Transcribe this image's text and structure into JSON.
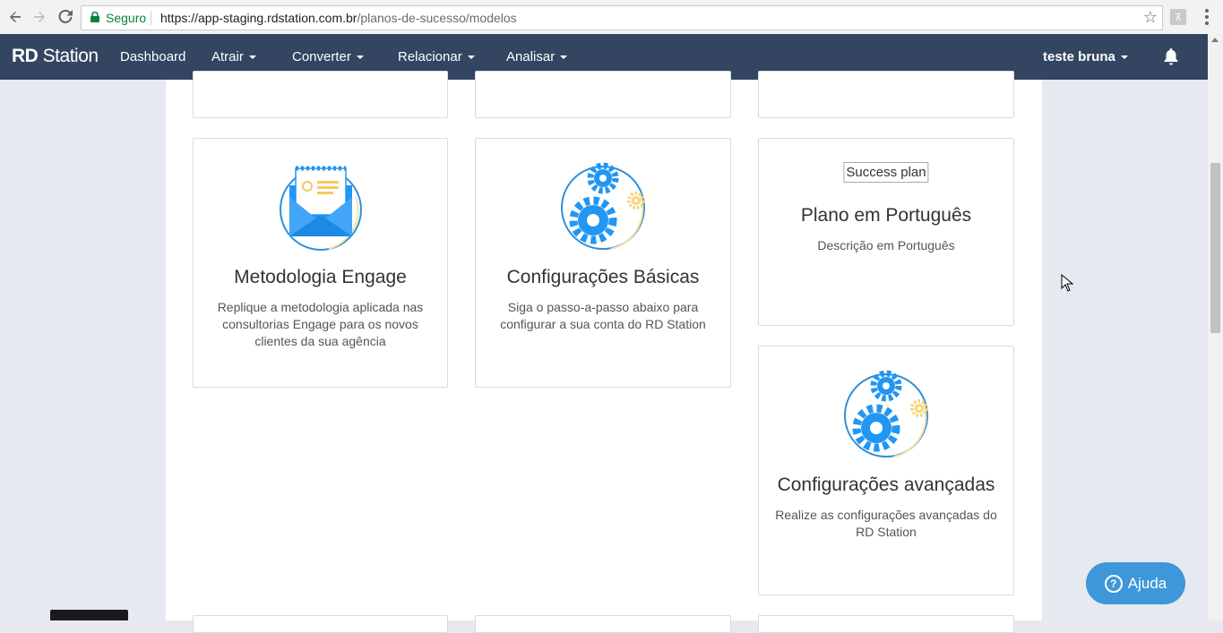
{
  "browser": {
    "secure_label": "Seguro",
    "url_host": "https://app-staging.rdstation.com.br",
    "url_path": "/planos-de-sucesso/modelos"
  },
  "nav": {
    "logo_bold": "RD",
    "logo_rest": " Station",
    "items": [
      "Dashboard",
      "Atrair",
      "Converter",
      "Relacionar",
      "Analisar"
    ],
    "user": "teste bruna"
  },
  "cards": [
    {
      "title": "Metodologia Engage",
      "description": "Replique a metodologia aplicada nas consultorias Engage para os novos clientes da sua agência",
      "icon": "envelope-icon"
    },
    {
      "title": "Configurações Básicas",
      "description": "Siga o passo-a-passo abaixo para configurar a sua conta do RD Station",
      "icon": "gears-icon"
    },
    {
      "title": "Plano em Português",
      "description": "Descrição em Português",
      "image_alt": "Success plan"
    },
    {
      "title": "Configurações avançadas",
      "description": "Realize as configurações avançadas do RD Station",
      "icon": "gears-icon"
    }
  ],
  "help": {
    "label": "Ajuda"
  },
  "colors": {
    "navbar": "#334561",
    "help_button": "#3e97d8",
    "page_bg": "#e7e9f1"
  }
}
